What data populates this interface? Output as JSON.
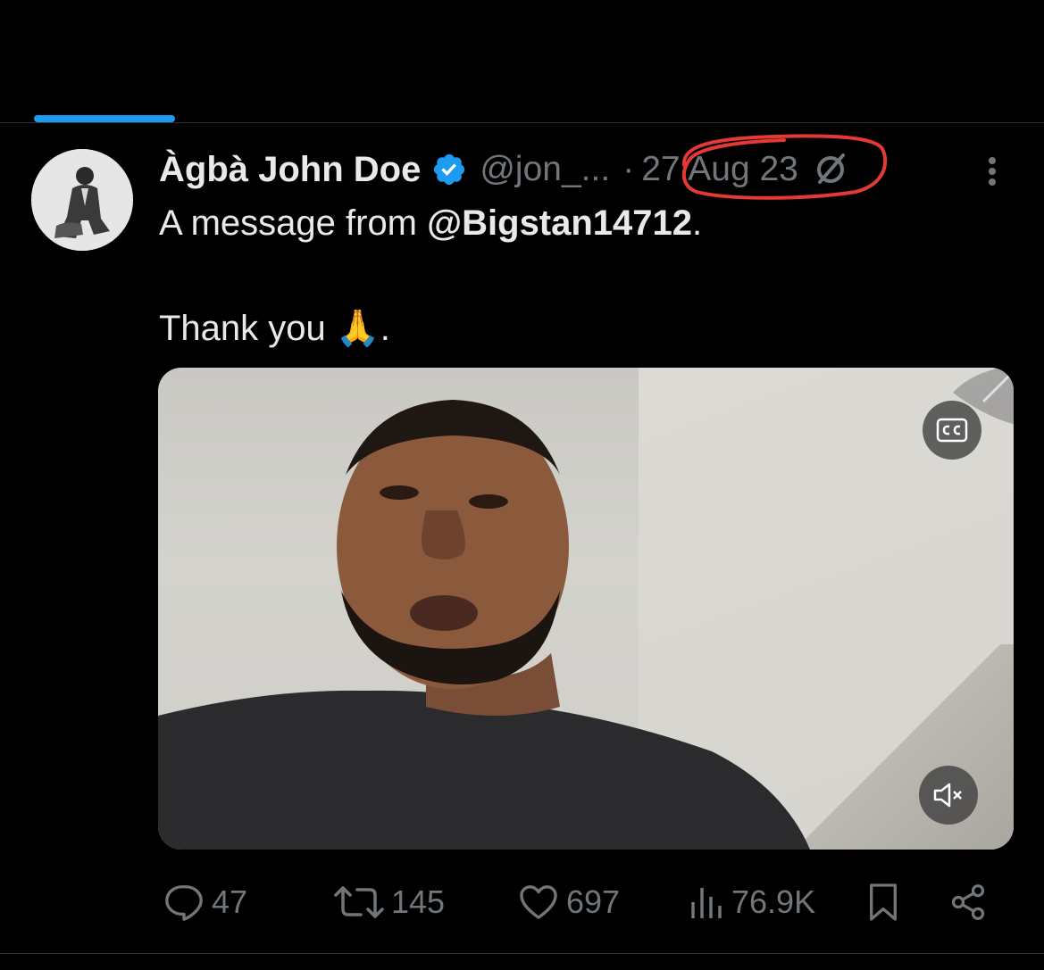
{
  "tweet": {
    "display_name": "Àgbà John Doe",
    "handle": "@jon_...",
    "separator": "·",
    "date": "27 Aug 23",
    "text_prefix": "A message from ",
    "mention": "@Bigstan14712",
    "text_suffix": ".",
    "line2": "Thank you 🙏."
  },
  "actions": {
    "replies": "47",
    "retweets": "145",
    "likes": "697",
    "views": "76.9K"
  },
  "colors": {
    "accent": "#1d9bf0",
    "annotation": "#e53935",
    "muted": "#71767b"
  }
}
